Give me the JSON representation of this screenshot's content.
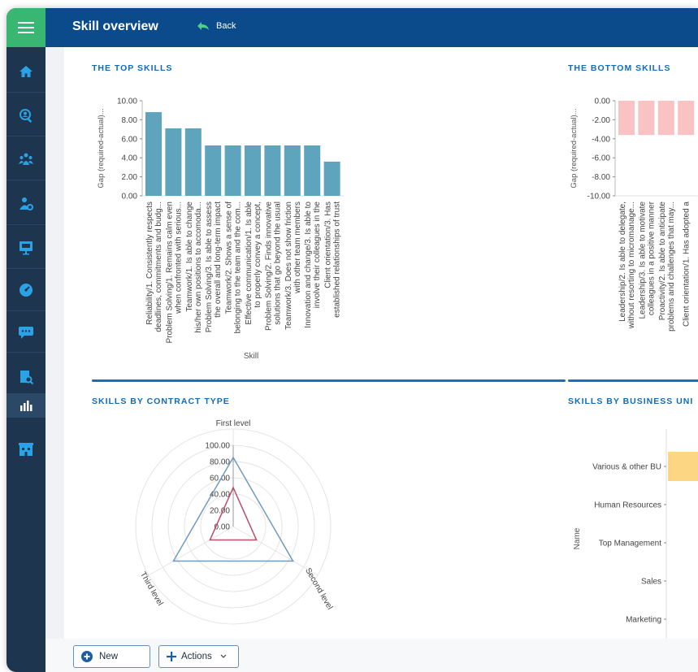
{
  "header": {
    "title": "Skill overview",
    "back_label": "Back"
  },
  "colors": {
    "sidebar": "#1e3550",
    "menu_button": "#3ab673",
    "topbar": "#0b4b8c",
    "bar_top": "#5da4bc",
    "bar_bottom": "#f9c3c3",
    "radar_series1": "#6e9bc1",
    "radar_series2": "#b94c69",
    "bu_bar": "#fcd683",
    "section_title": "#0f6bbf"
  },
  "sidebar": {
    "items": [
      {
        "icon": "home-icon"
      },
      {
        "icon": "search-user-icon"
      },
      {
        "icon": "team-icon"
      },
      {
        "icon": "user-settings-icon"
      },
      {
        "icon": "presentation-icon"
      },
      {
        "icon": "gauge-icon"
      },
      {
        "icon": "chat-icon"
      },
      {
        "icon": "document-search-icon"
      },
      {
        "icon": "bar-chart-icon",
        "active": true
      },
      {
        "icon": "building-icon"
      }
    ]
  },
  "sections": {
    "top_skills": "THE TOP SKILLS",
    "bottom_skills": "THE BOTTOM SKILLS",
    "contract": "SKILLS BY CONTRACT TYPE",
    "business_unit": "SKILLS BY BUSINESS UNI"
  },
  "actions": {
    "new_label": "New",
    "actions_label": "Actions"
  },
  "chart_data": [
    {
      "type": "bar",
      "title": "THE TOP SKILLS",
      "xlabel": "Skill",
      "ylabel": "Gap (required-actual)...",
      "ylim": [
        0,
        10
      ],
      "yticks": [
        "0.00",
        "2.00",
        "4.00",
        "6.00",
        "8.00",
        "10.00"
      ],
      "grid": false,
      "categories": [
        "Reliability/1. Consistently respects deadlines, commitments and budg...",
        "Problem Solving/1. Remains calm even when confronted with serious...",
        "Teamwork/1. Is able to change his/her own positions to accomoda...",
        "Problem Solving/3. Is able to assess the overall and long-term impact of...",
        "Teamwork/2. Shows a sense of belonging to the team and the com...",
        "Effective communication/1. Is able to properly convey a concept, without...",
        "Problem Solving/2. Finds innovative solutions that go beyond the usual",
        "Teamwork/3. Does not show friction with other team members",
        "Innovation and change/3. Is able to involve their colleagues in the proc...",
        "Client orientation/3. Has established relationships of trust with all stakeh..."
      ],
      "values": [
        8.8,
        7.1,
        7.1,
        5.3,
        5.3,
        5.3,
        5.3,
        5.3,
        5.3,
        3.6
      ]
    },
    {
      "type": "bar",
      "title": "THE BOTTOM SKILLS",
      "ylabel": "Gap (required-actual)...",
      "ylim": [
        -10,
        0
      ],
      "yticks": [
        "0.00",
        "-2.00",
        "-4.00",
        "-6.00",
        "-8.00",
        "-10.00"
      ],
      "grid": false,
      "categories": [
        "Leadership/2. Is able to delegate, without resorting to micromanage...",
        "Leadership/3. Is able to motivate colleagues in a positive manner",
        "Proactivity/2. Is able to anticipate problems and challenges that may...",
        "Client orientation/1. Has adopted a"
      ],
      "values": [
        -3.6,
        -3.6,
        -3.6,
        -3.6
      ]
    },
    {
      "type": "radar",
      "title": "SKILLS BY CONTRACT TYPE",
      "axes": [
        "First level",
        "Second level",
        "Third level"
      ],
      "rlim": [
        0,
        100
      ],
      "rticks": [
        "0.00",
        "20.00",
        "40.00",
        "60.00",
        "80.00",
        "100.00"
      ],
      "series": [
        {
          "values": [
            85,
            85,
            85
          ]
        },
        {
          "values": [
            48,
            33,
            33
          ]
        }
      ]
    },
    {
      "type": "bar",
      "orientation": "horizontal",
      "title": "SKILLS BY BUSINESS UNI",
      "ylabel": "Name",
      "categories": [
        "Various & other BU",
        "Human Resources",
        "Top Management",
        "Sales",
        "Marketing"
      ],
      "values": [
        1,
        null,
        null,
        null,
        null
      ]
    }
  ]
}
